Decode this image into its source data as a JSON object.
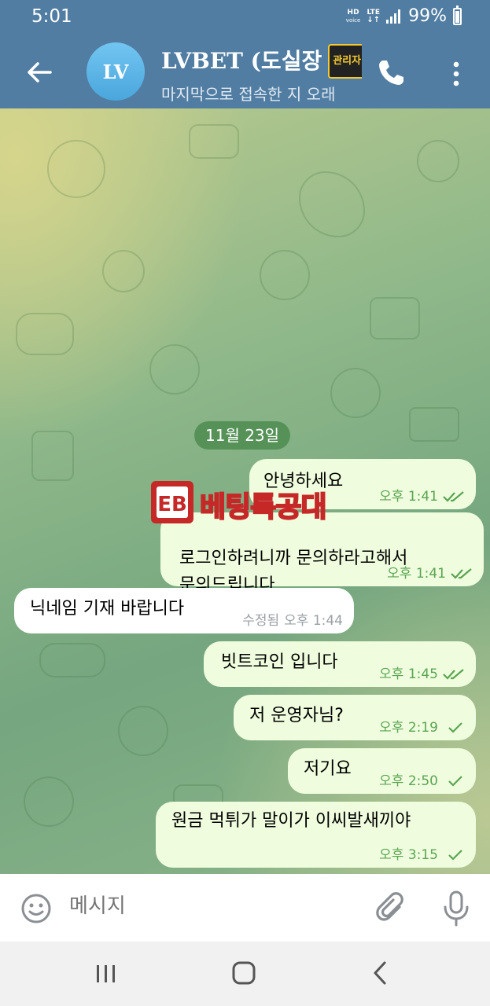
{
  "status": {
    "time": "5:01",
    "hd": "HD",
    "voice": "voice",
    "lte": "LTE",
    "battery": "99%"
  },
  "header": {
    "avatar_initials": "LV",
    "title": "LVBET (도실장",
    "badge": "관리자",
    "subtitle": "마지막으로 접속한 지 오래"
  },
  "chat": {
    "date_separator": "11월 23일",
    "watermark": "베팅특공대",
    "messages": [
      {
        "direction": "out",
        "text": "안녕하세요",
        "time": "오후 1:41",
        "status": "read"
      },
      {
        "direction": "out",
        "text": "로그인하려니까 문의하라고해서\n문의드립니다",
        "time": "오후 1:41",
        "status": "read"
      },
      {
        "direction": "in",
        "text": "닉네임 기재 바랍니다",
        "edited": "수정됨",
        "time": "오후 1:44"
      },
      {
        "direction": "out",
        "text": "빗트코인 입니다",
        "time": "오후 1:45",
        "status": "read"
      },
      {
        "direction": "out",
        "text": "저 운영자님?",
        "time": "오후 2:19",
        "status": "sent"
      },
      {
        "direction": "out",
        "text": "저기요",
        "time": "오후 2:50",
        "status": "sent"
      },
      {
        "direction": "out",
        "text": "원금 먹튀가 말이가 이씨발새끼야",
        "time": "오후 3:15",
        "status": "sent"
      }
    ]
  },
  "input": {
    "placeholder": "메시지"
  },
  "colors": {
    "header": "#517da2",
    "outgoing_bubble": "#effdde",
    "incoming_bubble": "#ffffff",
    "date_pill": "#4e8c50",
    "check": "#5ba453"
  }
}
